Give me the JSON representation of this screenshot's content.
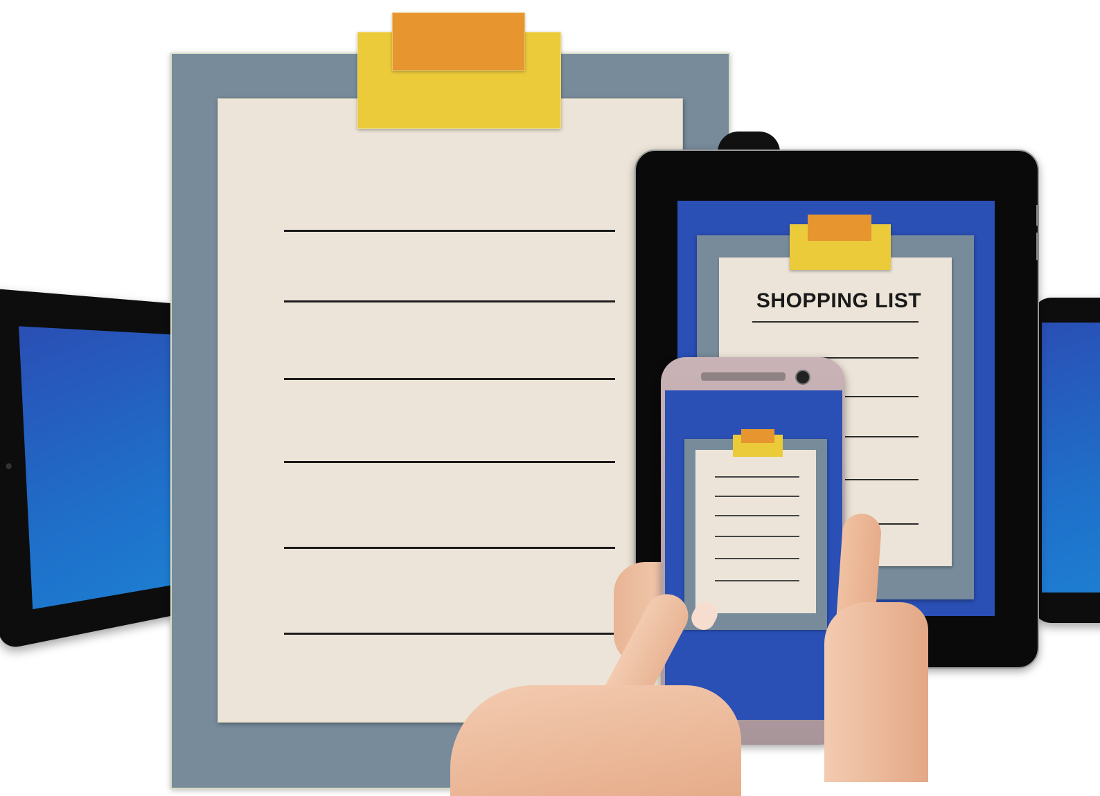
{
  "shopping_list": {
    "title": "SHOPPING LIST"
  },
  "colors": {
    "clipboard_board": "#7a8fa0",
    "paper": "#ece4d8",
    "clip_yellow": "#ebcb3a",
    "clip_orange": "#e6952f",
    "screen_blue": "#2a4fb5",
    "device_black": "#0d0d0d",
    "phone_frame": "#b8a3a6"
  },
  "icons": [
    "clipboard-icon",
    "tablet-icon",
    "smartphone-icon",
    "hand-icon"
  ]
}
